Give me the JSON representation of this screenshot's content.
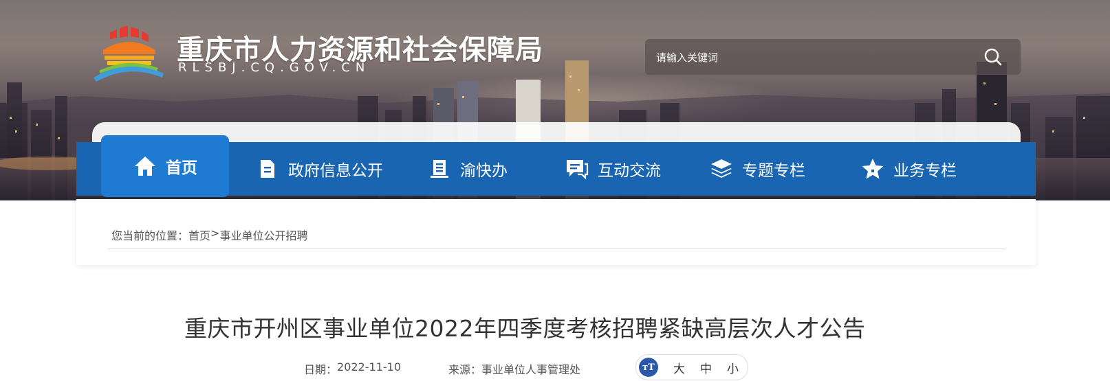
{
  "header": {
    "site_title": "重庆市人力资源和社会保障局",
    "site_domain": "RLSBJ.CQ.GOV.CN"
  },
  "search": {
    "placeholder": "请输入关键词",
    "button_icon": "search-icon"
  },
  "nav": {
    "items": [
      {
        "label": "首页",
        "icon": "home-icon",
        "active": true
      },
      {
        "label": "政府信息公开",
        "icon": "document-icon",
        "active": false
      },
      {
        "label": "渝快办",
        "icon": "notebook-icon",
        "active": false
      },
      {
        "label": "互动交流",
        "icon": "chat-icon",
        "active": false
      },
      {
        "label": "专题专栏",
        "icon": "layers-icon",
        "active": false
      },
      {
        "label": "业务专栏",
        "icon": "star-icon",
        "active": false
      }
    ]
  },
  "breadcrumb": {
    "prefix": "您当前的位置：",
    "home": "首页",
    "separator": ">",
    "current": "事业单位公开招聘"
  },
  "article": {
    "title": "重庆市开州区事业单位2022年四季度考核招聘紧缺高层次人才公告",
    "date_label": "日期：",
    "date": "2022-11-10",
    "source_label": "来源：",
    "source": "事业单位人事管理处",
    "font_size": {
      "icon_text": "тT",
      "options": [
        "大",
        "中",
        "小"
      ]
    }
  },
  "colors": {
    "nav_background": "#1965b2",
    "nav_active": "#1f7bd1",
    "title_text": "#333333",
    "font_icon_bg": "#2b57a8"
  }
}
